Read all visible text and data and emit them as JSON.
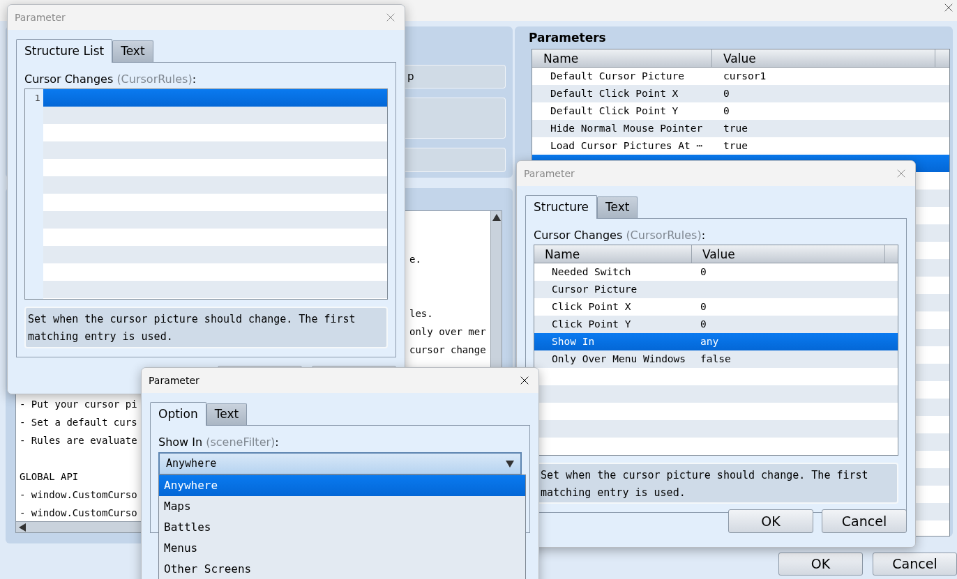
{
  "main_window": {
    "group_button_label": "p",
    "help_text_lines": [
      {
        "kind": "blank"
      },
      {
        "kind": "blank"
      },
      {
        "kind": "text",
        "right": "e."
      },
      {
        "kind": "blank"
      },
      {
        "kind": "blank"
      },
      {
        "kind": "text",
        "right": "les."
      },
      {
        "kind": "text",
        "right": "only over mer"
      },
      {
        "kind": "text",
        "right": "cursor change"
      },
      {
        "kind": "blank"
      },
      {
        "kind": "blank"
      },
      {
        "kind": "text",
        "left": "- Put your cursor pi"
      },
      {
        "kind": "text",
        "left": "- Set a default curs"
      },
      {
        "kind": "text",
        "left": "- Rules are evaluate"
      },
      {
        "kind": "blank"
      },
      {
        "kind": "text",
        "left": "GLOBAL API"
      },
      {
        "kind": "text",
        "left": "- window.CustomCurso"
      },
      {
        "kind": "text",
        "left": "- window.CustomCurso"
      }
    ],
    "parameters": {
      "title": "Parameters",
      "columns": [
        "Name",
        "Value"
      ],
      "rows": [
        {
          "name": "Default Cursor Picture",
          "value": "cursor1",
          "selected": false
        },
        {
          "name": "Default Click Point X",
          "value": "0",
          "selected": false
        },
        {
          "name": "Default Click Point Y",
          "value": "0",
          "selected": false
        },
        {
          "name": "Hide Normal Mouse Pointer",
          "value": "true",
          "selected": false
        },
        {
          "name": "Load Cursor Pictures At ⋯",
          "value": "true",
          "selected": false
        },
        {
          "selected": true
        }
      ]
    },
    "buttons": [
      "OK",
      "Cancel"
    ]
  },
  "dialogs": [
    {
      "kind": "list",
      "title": "Parameter",
      "active": false,
      "tabs": [
        {
          "label": "Structure List",
          "selected": true
        },
        {
          "label": "Text",
          "selected": false
        }
      ],
      "field_label": "Cursor Changes",
      "field_key": "(CursorRules)",
      "label_colon": ":",
      "list_rows": [
        {
          "number": "1",
          "selected": true
        }
      ],
      "description": "Set when the cursor picture should change. The first matching entry is used."
    },
    {
      "kind": "structure",
      "title": "Parameter",
      "active": false,
      "tabs": [
        {
          "label": "Structure",
          "selected": true
        },
        {
          "label": "Text",
          "selected": false
        }
      ],
      "field_label": "Cursor Changes",
      "field_key": "(CursorRules)",
      "label_colon": ":",
      "columns": [
        "Name",
        "Value"
      ],
      "rows": [
        {
          "name": "Needed Switch",
          "value": "0",
          "selected": false
        },
        {
          "name": "Cursor Picture",
          "selected": false
        },
        {
          "name": "Click Point X",
          "value": "0",
          "selected": false
        },
        {
          "name": "Click Point Y",
          "value": "0",
          "selected": false
        },
        {
          "name": "Show In",
          "value": "any",
          "selected": true
        },
        {
          "name": "Only Over Menu Windows",
          "value": "false",
          "selected": false
        }
      ],
      "description": "Set when the cursor picture should change. The first matching entry is used.",
      "buttons": [
        "OK",
        "Cancel"
      ]
    },
    {
      "kind": "option",
      "title": "Parameter",
      "active": true,
      "tabs": [
        {
          "label": "Option",
          "selected": true
        },
        {
          "label": "Text",
          "selected": false
        }
      ],
      "field_label": "Show In",
      "field_key": "(sceneFilter)",
      "label_colon": ":",
      "value": "Anywhere",
      "options": [
        {
          "label": "Anywhere",
          "selected": true
        },
        {
          "label": "Maps",
          "selected": false
        },
        {
          "label": "Battles",
          "selected": false
        },
        {
          "label": "Menus",
          "selected": false
        },
        {
          "label": "Other Screens",
          "selected": false
        }
      ]
    }
  ]
}
